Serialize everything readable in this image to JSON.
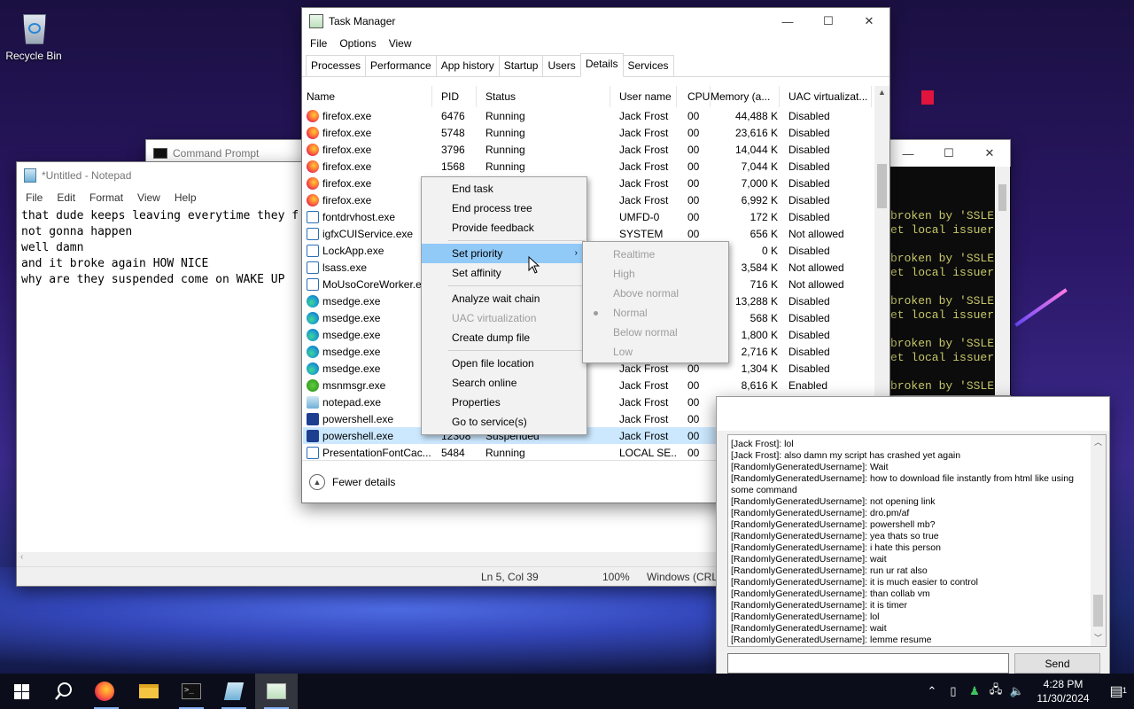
{
  "desktop": {
    "recycle_bin_label": "Recycle Bin"
  },
  "cmd": {
    "title": "Command Prompt",
    "console_lines": [
      "broken by 'SSLE",
      "et local issuer",
      "",
      "broken by 'SSLE",
      "et local issuer",
      "",
      "broken by 'SSLE",
      "et local issuer",
      "",
      "broken by 'SSLE",
      "et local issuer",
      "",
      "broken by 'SSLE"
    ]
  },
  "notepad": {
    "title": "*Untitled - Notepad",
    "menu": [
      "File",
      "Edit",
      "Format",
      "View",
      "Help"
    ],
    "text": "that dude keeps leaving everytime they f\nnot gonna happen\nwell damn\nand it broke again HOW NICE\nwhy are they suspended come on WAKE UP",
    "status_pos": "Ln 5, Col 39",
    "status_zoom": "100%",
    "status_eol": "Windows (CRL"
  },
  "taskmanager": {
    "title": "Task Manager",
    "menu": [
      "File",
      "Options",
      "View"
    ],
    "tabs": [
      "Processes",
      "Performance",
      "App history",
      "Startup",
      "Users",
      "Details",
      "Services"
    ],
    "active_tab": "Details",
    "columns": [
      "Name",
      "PID",
      "Status",
      "User name",
      "CPU",
      "Memory (a...",
      "UAC virtualizat..."
    ],
    "rows": [
      {
        "icon": "firefox",
        "name": "firefox.exe",
        "pid": "6476",
        "status": "Running",
        "user": "Jack Frost",
        "cpu": "00",
        "mem": "44,488 K",
        "uac": "Disabled"
      },
      {
        "icon": "firefox",
        "name": "firefox.exe",
        "pid": "5748",
        "status": "Running",
        "user": "Jack Frost",
        "cpu": "00",
        "mem": "23,616 K",
        "uac": "Disabled"
      },
      {
        "icon": "firefox",
        "name": "firefox.exe",
        "pid": "3796",
        "status": "Running",
        "user": "Jack Frost",
        "cpu": "00",
        "mem": "14,044 K",
        "uac": "Disabled"
      },
      {
        "icon": "firefox",
        "name": "firefox.exe",
        "pid": "1568",
        "status": "Running",
        "user": "Jack Frost",
        "cpu": "00",
        "mem": "7,044 K",
        "uac": "Disabled"
      },
      {
        "icon": "firefox",
        "name": "firefox.exe",
        "pid": "",
        "status": "",
        "user": "Jack Frost",
        "cpu": "00",
        "mem": "7,000 K",
        "uac": "Disabled"
      },
      {
        "icon": "firefox",
        "name": "firefox.exe",
        "pid": "",
        "status": "",
        "user": "Jack Frost",
        "cpu": "00",
        "mem": "6,992 K",
        "uac": "Disabled"
      },
      {
        "icon": "sys",
        "name": "fontdrvhost.exe",
        "pid": "",
        "status": "",
        "user": "UMFD-0",
        "cpu": "00",
        "mem": "172 K",
        "uac": "Disabled"
      },
      {
        "icon": "sys",
        "name": "igfxCUIService.exe",
        "pid": "",
        "status": "",
        "user": "SYSTEM",
        "cpu": "00",
        "mem": "656 K",
        "uac": "Not allowed"
      },
      {
        "icon": "sys",
        "name": "LockApp.exe",
        "pid": "",
        "status": "",
        "user": "",
        "cpu": "",
        "mem": "0 K",
        "uac": "Disabled"
      },
      {
        "icon": "sys",
        "name": "lsass.exe",
        "pid": "",
        "status": "",
        "user": "",
        "cpu": "",
        "mem": "3,584 K",
        "uac": "Not allowed"
      },
      {
        "icon": "sys",
        "name": "MoUsoCoreWorker.e",
        "pid": "",
        "status": "",
        "user": "",
        "cpu": "",
        "mem": "716 K",
        "uac": "Not allowed"
      },
      {
        "icon": "edge",
        "name": "msedge.exe",
        "pid": "",
        "status": "",
        "user": "",
        "cpu": "",
        "mem": "13,288 K",
        "uac": "Disabled"
      },
      {
        "icon": "edge",
        "name": "msedge.exe",
        "pid": "",
        "status": "",
        "user": "",
        "cpu": "",
        "mem": "568 K",
        "uac": "Disabled"
      },
      {
        "icon": "edge",
        "name": "msedge.exe",
        "pid": "",
        "status": "",
        "user": "",
        "cpu": "",
        "mem": "1,800 K",
        "uac": "Disabled"
      },
      {
        "icon": "edge",
        "name": "msedge.exe",
        "pid": "",
        "status": "",
        "user": "",
        "cpu": "",
        "mem": "2,716 K",
        "uac": "Disabled"
      },
      {
        "icon": "edge",
        "name": "msedge.exe",
        "pid": "",
        "status": "",
        "user": "Jack Frost",
        "cpu": "00",
        "mem": "1,304 K",
        "uac": "Disabled"
      },
      {
        "icon": "msn",
        "name": "msnmsgr.exe",
        "pid": "",
        "status": "",
        "user": "Jack Frost",
        "cpu": "00",
        "mem": "8,616 K",
        "uac": "Enabled"
      },
      {
        "icon": "np",
        "name": "notepad.exe",
        "pid": "",
        "status": "",
        "user": "Jack Frost",
        "cpu": "00",
        "mem": "",
        "uac": ""
      },
      {
        "icon": "ps",
        "name": "powershell.exe",
        "pid": "",
        "status": "",
        "user": "Jack Frost",
        "cpu": "00",
        "mem": "",
        "uac": ""
      },
      {
        "icon": "ps",
        "name": "powershell.exe",
        "pid": "12308",
        "status": "Suspended",
        "user": "Jack Frost",
        "cpu": "00",
        "mem": "",
        "uac": "",
        "selected": true
      },
      {
        "icon": "sys",
        "name": "PresentationFontCac...",
        "pid": "5484",
        "status": "Running",
        "user": "LOCAL SE...",
        "cpu": "00",
        "mem": "",
        "uac": ""
      }
    ],
    "fewer_details": "Fewer details"
  },
  "context_menu": {
    "items": [
      {
        "label": "End task"
      },
      {
        "label": "End process tree"
      },
      {
        "label": "Provide feedback"
      },
      {
        "sep": true
      },
      {
        "label": "Set priority",
        "highlight": true,
        "submenu": true
      },
      {
        "label": "Set affinity"
      },
      {
        "sep": true
      },
      {
        "label": "Analyze wait chain"
      },
      {
        "label": "UAC virtualization",
        "disabled": true
      },
      {
        "label": "Create dump file"
      },
      {
        "sep": true
      },
      {
        "label": "Open file location"
      },
      {
        "label": "Search online"
      },
      {
        "label": "Properties"
      },
      {
        "label": "Go to service(s)"
      }
    ],
    "priority_submenu": [
      "Realtime",
      "High",
      "Above normal",
      "Normal",
      "Below normal",
      "Low"
    ],
    "priority_selected": "Normal"
  },
  "chat": {
    "messages": [
      "[Jack Frost]: lol",
      "[Jack Frost]: also damn my script has crashed yet again",
      "[RandomlyGeneratedUsername]: Wait",
      "[RandomlyGeneratedUsername]: how to download file instantly from html like using some command",
      "[RandomlyGeneratedUsername]: not opening link",
      "[RandomlyGeneratedUsername]: dro.pm/af",
      "[RandomlyGeneratedUsername]: powershell mb?",
      "[RandomlyGeneratedUsername]: yea thats so true",
      "[RandomlyGeneratedUsername]: i hate this person",
      "[RandomlyGeneratedUsername]: wait",
      "[RandomlyGeneratedUsername]: run ur rat also",
      "[RandomlyGeneratedUsername]: it is much easier to control",
      "[RandomlyGeneratedUsername]: than collab vm",
      "[RandomlyGeneratedUsername]: it is timer",
      "[RandomlyGeneratedUsername]: lol",
      "[RandomlyGeneratedUsername]: wait",
      "[RandomlyGeneratedUsername]: lemme resume"
    ],
    "input_value": "",
    "send_label": "Send"
  },
  "taskbar": {
    "apps": [
      "start",
      "search",
      "firefox",
      "file-explorer",
      "command-prompt",
      "notepad",
      "task-manager"
    ],
    "time": "4:28 PM",
    "date": "11/30/2024",
    "notification_count": "1"
  }
}
